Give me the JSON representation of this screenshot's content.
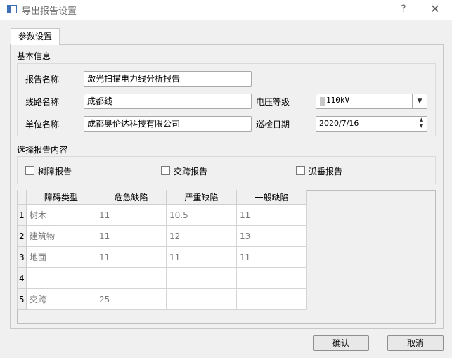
{
  "window": {
    "title": "导出报告设置",
    "help_glyph": "?",
    "close_glyph": "✕"
  },
  "tabs": [
    {
      "label": "参数设置"
    }
  ],
  "basic_info": {
    "section_label": "基本信息",
    "report_name_label": "报告名称",
    "report_name_value": "激光扫描电力线分析报告",
    "line_name_label": "线路名称",
    "line_name_value": "成都线",
    "voltage_label": "电压等级",
    "voltage_value": "110kV",
    "unit_name_label": "单位名称",
    "unit_name_value": "成都奥伦达科技有限公司",
    "inspection_date_label": "巡检日期",
    "inspection_date_value": "2020/7/16"
  },
  "report_content": {
    "section_label": "选择报告内容",
    "options": [
      {
        "label": "树障报告",
        "checked": false
      },
      {
        "label": "交跨报告",
        "checked": false
      },
      {
        "label": "弧垂报告",
        "checked": false
      }
    ]
  },
  "table": {
    "headers": [
      "障碍类型",
      "危急缺陷",
      "严重缺陷",
      "一般缺陷"
    ],
    "rows": [
      {
        "num": "1",
        "cells": [
          "树木",
          "11",
          "10.5",
          "11"
        ]
      },
      {
        "num": "2",
        "cells": [
          "建筑物",
          "11",
          "12",
          "13"
        ]
      },
      {
        "num": "3",
        "cells": [
          "地面",
          "11",
          "11",
          "11"
        ]
      },
      {
        "num": "4",
        "cells": [
          "",
          "",
          "",
          ""
        ]
      },
      {
        "num": "5",
        "cells": [
          "交跨",
          "25",
          "--",
          "--"
        ]
      }
    ]
  },
  "buttons": {
    "confirm": "确认",
    "cancel": "取消"
  },
  "icons": {
    "combo_arrow": "chevron-down-icon",
    "spin_up": "▲",
    "spin_down": "▼",
    "combo_arrow_glyph": "▼"
  }
}
